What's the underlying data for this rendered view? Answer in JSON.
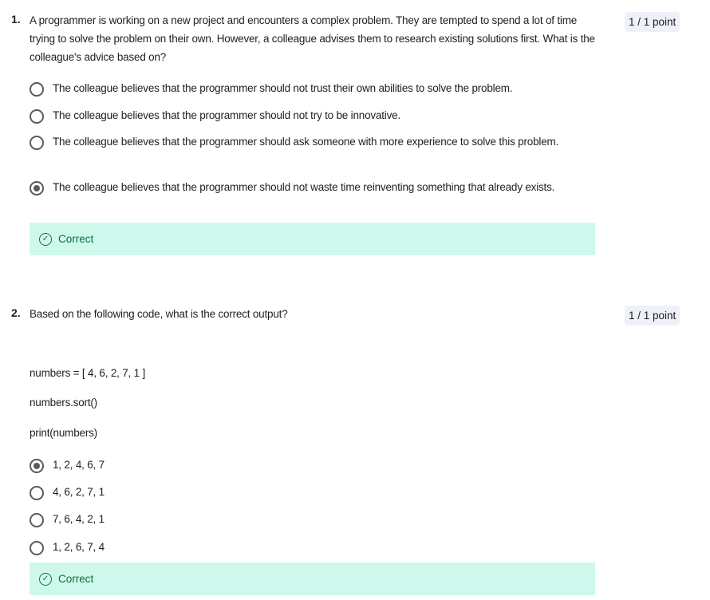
{
  "questions": [
    {
      "number": "1.",
      "text": "A programmer is working on a new project and encounters a complex problem. They are tempted to spend a lot of time trying to solve the problem on their own. However, a colleague advises them to research existing solutions first. What is the colleague's advice based on?",
      "points": "1 / 1 point",
      "options": [
        {
          "label": "The colleague believes that the programmer should not trust their own abilities to solve the problem.",
          "selected": false
        },
        {
          "label": "The colleague believes that the programmer should not try to be innovative.",
          "selected": false
        },
        {
          "label": "The colleague believes that the programmer should ask someone with more experience to solve this problem.",
          "selected": false
        },
        {
          "label": "The colleague believes that the programmer should not waste time reinventing something that already exists.",
          "selected": true
        }
      ],
      "feedback": "Correct"
    },
    {
      "number": "2.",
      "text": "Based on the following code, what is the correct output?",
      "points": "1 / 1 point",
      "code": [
        "numbers = [ 4, 6, 2, 7, 1 ]",
        "numbers.sort()",
        "print(numbers)"
      ],
      "options": [
        {
          "label": "1, 2, 4, 6, 7",
          "selected": true
        },
        {
          "label": "4, 6, 2, 7, 1",
          "selected": false
        },
        {
          "label": "7, 6, 4, 2, 1",
          "selected": false
        },
        {
          "label": "1, 2, 6, 7, 4",
          "selected": false
        }
      ],
      "feedback": "Correct"
    }
  ],
  "colors": {
    "feedback_bg": "#cff8ec",
    "feedback_text": "#0b6e3a",
    "badge_bg": "#eef1f8"
  }
}
